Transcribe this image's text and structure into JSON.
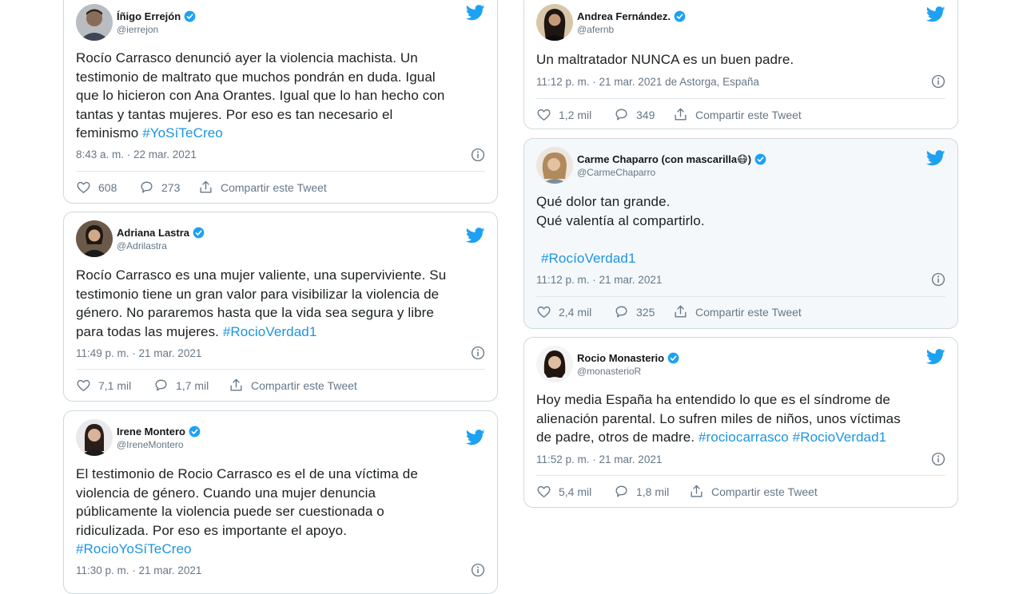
{
  "labels": {
    "share": "Compartir este Tweet"
  },
  "colors": {
    "link": "#1b95e0",
    "muted": "#657786",
    "verified": "#1da1f2",
    "border": "#cfd9de"
  },
  "tweets": [
    {
      "name": "Íñigo Errejón",
      "handle": "@ierrejon",
      "text_lines": [
        "Rocío Carrasco denunció ayer la violencia machista. Un",
        "testimonio de maltrato que muchos pondrán en duda. Igual",
        "que lo hicieron con Ana Orantes. Igual que lo han hecho con",
        "tantas y tantas mujeres. Por eso es tan necesario el",
        "feminismo "
      ],
      "hashtags": [
        "#YoSíTeCreo"
      ],
      "time": "8:43 a. m. · 22 mar. 2021",
      "likes": "608",
      "replies": "273"
    },
    {
      "name": "Adriana Lastra",
      "handle": "@Adrilastra",
      "text_lines": [
        "Rocío Carrasco es una mujer valiente, una superviviente. Su",
        "testimonio tiene un gran valor para visibilizar la violencia de",
        "género. No pararemos hasta que la vida sea segura y libre",
        "para todas las mujeres. "
      ],
      "hashtags": [
        "#RocioVerdad1"
      ],
      "time": "11:49 p. m. · 21 mar. 2021",
      "likes": "7,1 mil",
      "replies": "1,7 mil"
    },
    {
      "name": "Irene Montero",
      "handle": "@IreneMontero",
      "text_lines": [
        "El testimonio de Rocio Carrasco es el de una víctima de",
        "violencia de género. Cuando una mujer denuncia",
        "públicamente la violencia puede ser cuestionada o",
        "ridiculizada. Por eso es importante el apoyo.",
        ""
      ],
      "hashtags": [
        "#RocioYoSíTeCreo"
      ],
      "time": "11:30 p. m. · 21 mar. 2021"
    },
    {
      "name": "Andrea Fernández.",
      "handle": "@afernb",
      "text_lines": [
        "Un maltratador NUNCA es un buen padre."
      ],
      "hashtags": [],
      "time": "11:12 p. m. · 21 mar. 2021 de Astorga, España",
      "likes": "1,2 mil",
      "replies": "349"
    },
    {
      "name": "Carme Chaparro (con mascarilla",
      "handle": "@CarmeChaparro",
      "emoji": "😷",
      "name_end": ")",
      "text_lines": [
        "Qué dolor tan grande.",
        "Qué valentía al compartirlo.",
        "",
        ""
      ],
      "hashtags": [
        "#RocíoVerdad1"
      ],
      "time": "11:12 p. m. · 21 mar. 2021",
      "likes": "2,4 mil",
      "replies": "325"
    },
    {
      "name": "Rocio Monasterio",
      "handle": "@monasterioR",
      "text_lines": [
        "Hoy media España ha entendido lo que es el síndrome de",
        "alienación parental. Lo sufren miles de niños, unos víctimas",
        "de padre, otros de madre. "
      ],
      "hashtags": [
        "#rociocarrasco",
        "#RocioVerdad1"
      ],
      "time": "11:52 p. m. · 21 mar. 2021",
      "likes": "5,4 mil",
      "replies": "1,8 mil"
    }
  ]
}
